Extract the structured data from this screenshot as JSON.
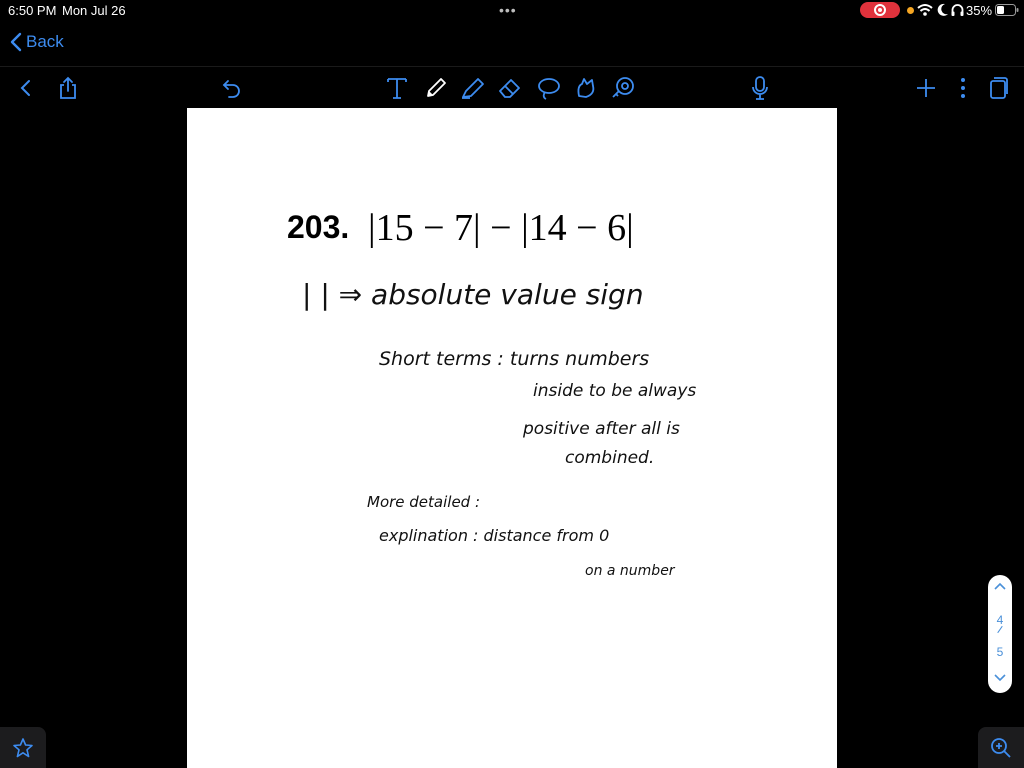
{
  "status_bar": {
    "time": "6:50 PM",
    "date": "Mon Jul 26",
    "battery": "35%"
  },
  "nav": {
    "back_label": "Back"
  },
  "toolbar": {
    "icons": [
      "chevron-left",
      "share",
      "undo",
      "text-tool",
      "pen",
      "highlighter",
      "eraser",
      "lasso",
      "shapes",
      "sticker",
      "microphone",
      "add",
      "more",
      "pages"
    ],
    "accent_color": "#3d8cf0"
  },
  "document": {
    "problem_number": "203.",
    "expression": "|15 − 7| − |14 − 6|",
    "notes": {
      "line1": "| | ⇒ absolute value sign",
      "line2": "Short terms : turns numbers",
      "line3": "inside to be always",
      "line4": "positive after all is",
      "line5": "combined.",
      "line6": "More detailed :",
      "line7": "explination : distance from 0",
      "line8": "on a number"
    }
  },
  "pager": {
    "current": "4",
    "total": "5"
  }
}
